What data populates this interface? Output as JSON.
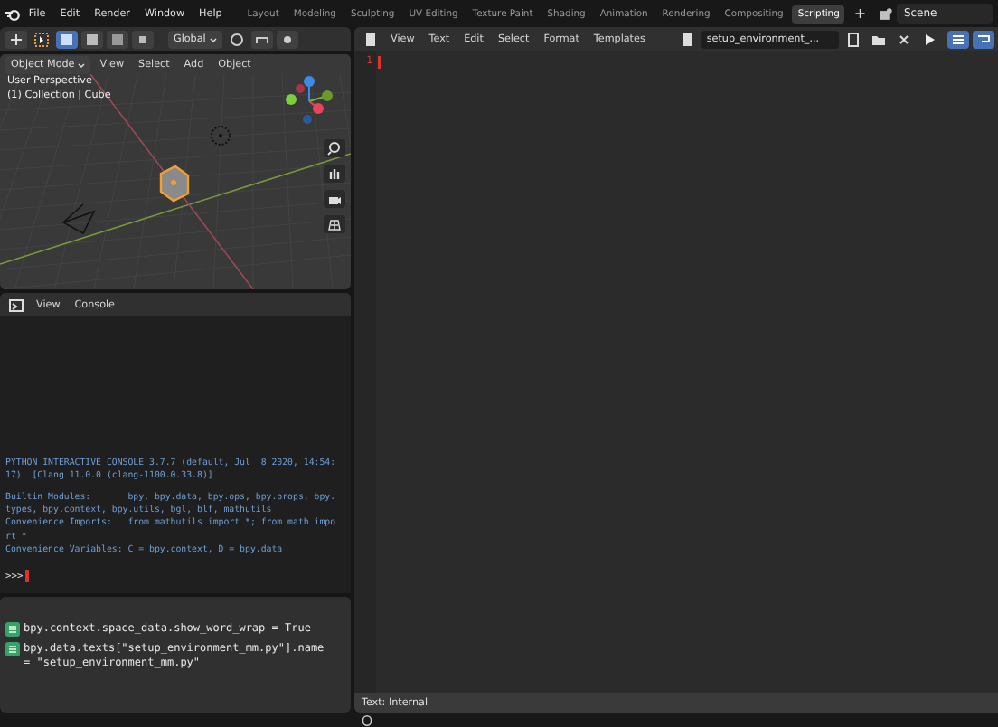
{
  "menu": [
    "File",
    "Edit",
    "Render",
    "Window",
    "Help"
  ],
  "workspaces": [
    {
      "label": "Layout",
      "selected": false
    },
    {
      "label": "Modeling",
      "selected": false
    },
    {
      "label": "Sculpting",
      "selected": false
    },
    {
      "label": "UV Editing",
      "selected": false
    },
    {
      "label": "Texture Paint",
      "selected": false
    },
    {
      "label": "Shading",
      "selected": false
    },
    {
      "label": "Animation",
      "selected": false
    },
    {
      "label": "Rendering",
      "selected": false
    },
    {
      "label": "Compositing",
      "selected": false
    },
    {
      "label": "Scripting",
      "selected": true
    }
  ],
  "add_workspace": "+",
  "scene": "Scene",
  "tool_header": {
    "transform": "Global"
  },
  "viewport": {
    "mode": "Object Mode",
    "menu": [
      "View",
      "Select",
      "Add",
      "Object"
    ],
    "overlay": [
      "User Perspective",
      "(1) Collection | Cube"
    ]
  },
  "console": {
    "menu": [
      "View",
      "Console"
    ],
    "blocks": [
      [
        "PYTHON INTERACTIVE CONSOLE 3.7.7 (default, Jul  8 2020, 14:54:",
        "17)  [Clang 11.0.0 (clang-1100.0.33.8)]"
      ],
      [
        "Builtin Modules:       bpy, bpy.data, bpy.ops, bpy.props, bpy.",
        "types, bpy.context, bpy.utils, bgl, blf, mathutils",
        "Convenience Imports:   from mathutils import *; from math impo",
        "rt *",
        "Convenience Variables: C = bpy.context, D = bpy.data"
      ]
    ],
    "prompt": ">>>"
  },
  "info": {
    "entries": [
      [
        "bpy.context.space_data.show_word_wrap = True"
      ],
      [
        "bpy.data.texts[\"setup_environment_mm.py\"].name",
        "= \"setup_environment_mm.py\""
      ]
    ]
  },
  "text_editor": {
    "menu": [
      "View",
      "Text",
      "Edit",
      "Select",
      "Format",
      "Templates"
    ],
    "file": "setup_environment_...",
    "line_numbers": [
      "1"
    ],
    "footer": "Text: Internal"
  }
}
